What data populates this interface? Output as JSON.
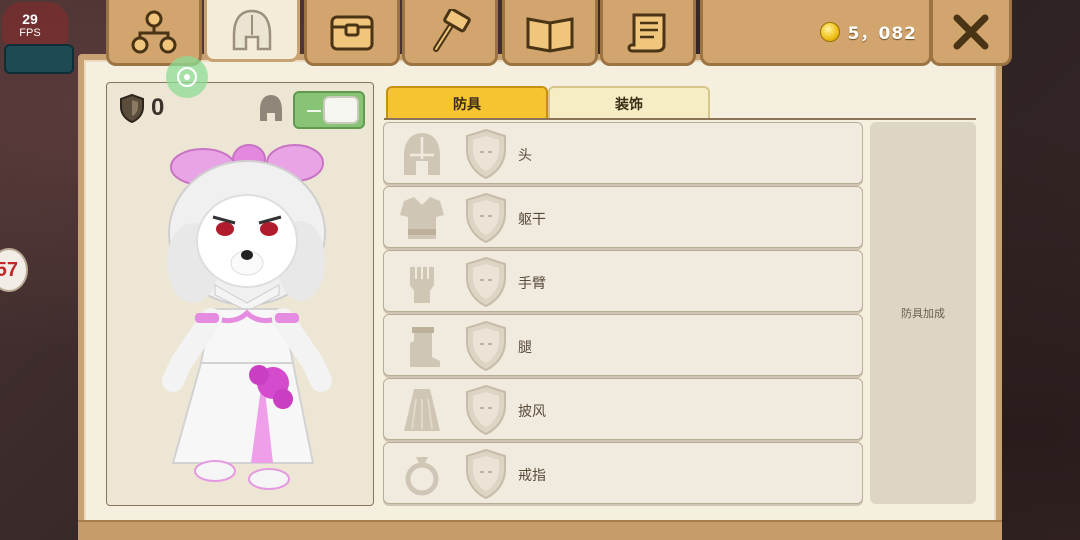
{
  "hud": {
    "fps_value": "29",
    "fps_label": "FPS",
    "side_badge": "57"
  },
  "header": {
    "tabs": [
      {
        "icon": "hierarchy-icon"
      },
      {
        "icon": "helmet-icon",
        "active": true
      },
      {
        "icon": "backpack-icon"
      },
      {
        "icon": "hammer-icon"
      },
      {
        "icon": "book-icon"
      },
      {
        "icon": "scroll-icon"
      }
    ],
    "coins": "5，082",
    "close_icon": "close-icon"
  },
  "preview": {
    "armor_value": "0",
    "toggle_on": true
  },
  "subtabs": {
    "armor": "防具",
    "decoration": "装饰"
  },
  "slots": [
    {
      "label": "头",
      "icon": "helmet-icon"
    },
    {
      "label": "躯干",
      "icon": "chestplate-icon"
    },
    {
      "label": "手臂",
      "icon": "gauntlet-icon"
    },
    {
      "label": "腿",
      "icon": "boot-icon"
    },
    {
      "label": "披风",
      "icon": "cape-icon"
    },
    {
      "label": "戒指",
      "icon": "ring-icon"
    }
  ],
  "bonus_label": "防具加成",
  "colors": {
    "panel_bg": "#f5efdf",
    "wood": "#d1a56d",
    "active_subtab": "#f6c431",
    "toggle_on": "#88c476"
  }
}
